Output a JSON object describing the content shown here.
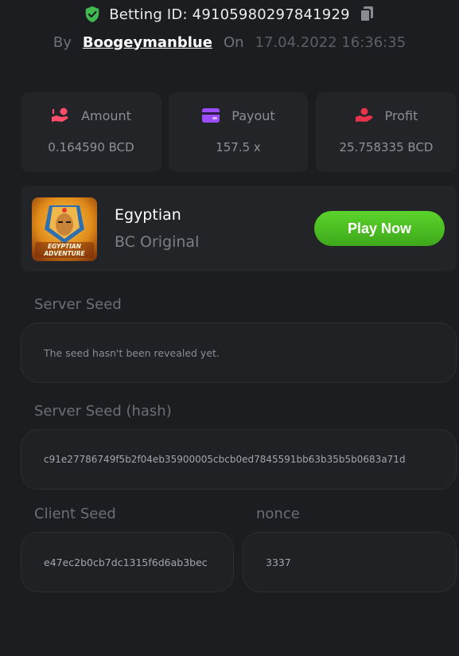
{
  "header": {
    "betting_id_label": "Betting ID: 49105980297841929",
    "by_label": "By",
    "username": "Boogeymanblue",
    "on_label": "On",
    "datetime": "17.04.2022 16:36:35"
  },
  "stats": [
    {
      "label": "Amount",
      "value": "0.164590 BCD",
      "icon": "coins-hand-icon"
    },
    {
      "label": "Payout",
      "value": "157.5 x",
      "icon": "wallet-card-icon"
    },
    {
      "label": "Profit",
      "value": "25.758335 BCD",
      "icon": "hand-coin-icon"
    }
  ],
  "game": {
    "name": "Egyptian",
    "provider": "BC Original",
    "thumbnail_text": "EGYPTIAN ADVENTURE",
    "play_label": "Play Now"
  },
  "server_seed": {
    "label": "Server Seed",
    "value": "The seed hasn't been revealed yet."
  },
  "server_seed_hash": {
    "label": "Server Seed (hash)",
    "value": "c91e27786749f5b2f04eb35900005cbcb0ed7845591bb63b35b5b0683a71d"
  },
  "client_seed": {
    "label": "Client Seed",
    "value": "e47ec2b0cb7dc1315f6d6ab3bec"
  },
  "nonce": {
    "label": "nonce",
    "value": "3337"
  },
  "colors": {
    "accent_green": "#4cc224",
    "shield_green": "#3fb950",
    "amount_icon": "#ff4d6a",
    "payout_icon": "#9b4dff",
    "profit_icon": "#e8344a"
  }
}
